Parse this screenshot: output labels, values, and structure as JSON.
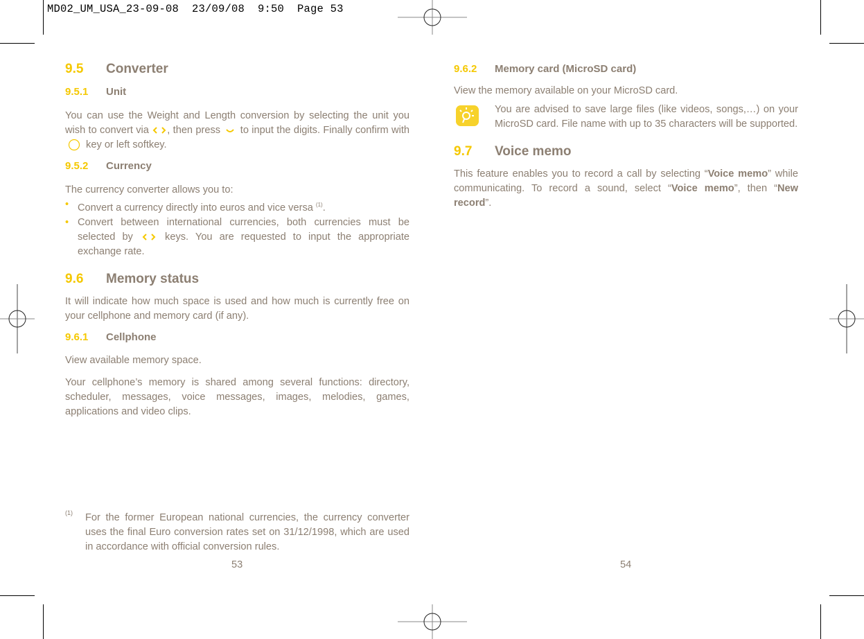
{
  "slug": "MD02_UM_USA_23-09-08  23/09/08  9:50  Page 53",
  "left_page": {
    "s95": {
      "num": "9.5",
      "title": "Converter"
    },
    "s951": {
      "num": "9.5.1",
      "title": "Unit"
    },
    "unit_text": {
      "a": "You can use the Weight and Length conversion by selecting the unit you wish to convert via ",
      "b": ", then press ",
      "c": " to input the digits. Finally confirm with ",
      "d": " key or left softkey."
    },
    "s952": {
      "num": "9.5.2",
      "title": "Currency"
    },
    "currency_intro": "The currency converter allows you to:",
    "bullets": {
      "b1": "Convert a currency directly into euros and vice versa ",
      "b1_sup": "(1)",
      "b1_end": ".",
      "b2a": "Convert between international currencies, both currencies must be selected by ",
      "b2b": " keys. You are requested to input the appropriate exchange rate."
    },
    "bullet_glyph": "•",
    "s96": {
      "num": "9.6",
      "title": "Memory status"
    },
    "memory_text": "It will indicate how much space is used and how much is currently free on your cellphone and memory card (if any).",
    "s961": {
      "num": "9.6.1",
      "title": "Cellphone"
    },
    "cellphone_text1": "View available memory space.",
    "cellphone_text2": "Your cellphone’s memory is shared among several functions: directory, scheduler, messages, voice messages, images, melodies, games, applications and video clips.",
    "footnote_mark": "(1)",
    "footnote_text": "For the former European national currencies, the currency converter uses the final Euro conversion rates set on 31/12/1998, which are used in accordance with official conversion rules.",
    "page_number": "53"
  },
  "right_page": {
    "s962": {
      "num": "9.6.2",
      "title": "Memory card (MicroSD card)"
    },
    "microsd_text": "View the memory available on your MicroSD card.",
    "tip_text": "You are advised to save large files (like videos, songs,…) on your MicroSD card. File name with up to 35 characters will be supported.",
    "s97": {
      "num": "9.7",
      "title": "Voice memo"
    },
    "voice": {
      "a": "This feature enables you to record a call by selecting “",
      "b1": "Voice memo",
      "c": "” while communicating. To record a sound, select “",
      "b2": "Voice memo",
      "d": "”, then “",
      "b3": "New record",
      "e": "”."
    },
    "page_number": "54"
  },
  "colors": {
    "accent": "#f5c800",
    "text": "#8c7f72"
  }
}
